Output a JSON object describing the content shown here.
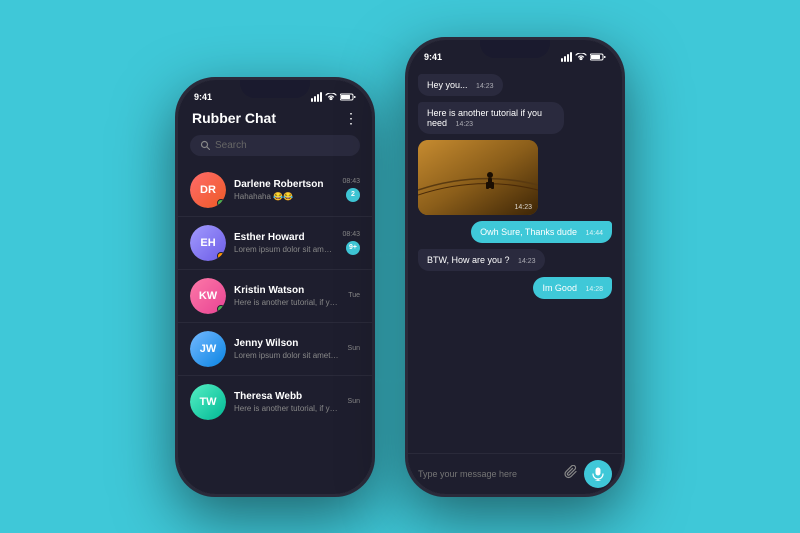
{
  "background_color": "#3fc8d8",
  "phone1": {
    "status_time": "9:41",
    "header_title": "Rubber Chat",
    "more_icon": "⋮",
    "search_placeholder": "Search",
    "chats": [
      {
        "name": "Darlene Robertson",
        "preview": "Hahahaha 😂😂",
        "time": "08:43",
        "badge": "2",
        "online": true,
        "dot_color": "green",
        "initials": "DR",
        "av_class": "av1"
      },
      {
        "name": "Esther Howard",
        "preview": "Lorem ipsum dolor sit amet, conse...",
        "time": "08:43",
        "badge": "9+",
        "online": true,
        "dot_color": "orange",
        "initials": "EH",
        "av_class": "av2"
      },
      {
        "name": "Kristin Watson",
        "preview": "Here is another tutorial, if you...",
        "time": "Tue",
        "badge": "",
        "online": true,
        "dot_color": "green",
        "initials": "KW",
        "av_class": "av3"
      },
      {
        "name": "Jenny Wilson",
        "preview": "Lorem ipsum dolor sit amet, conse...",
        "time": "Sun",
        "badge": "",
        "online": false,
        "dot_color": "",
        "initials": "JW",
        "av_class": "av4"
      },
      {
        "name": "Theresa Webb",
        "preview": "Here is another tutorial, if you...",
        "time": "Sun",
        "badge": "",
        "online": false,
        "dot_color": "",
        "initials": "TW",
        "av_class": "av5"
      }
    ]
  },
  "phone2": {
    "status_time": "9:41",
    "messages": [
      {
        "type": "received",
        "text": "Hey you...",
        "time": "14:23"
      },
      {
        "type": "received",
        "text": "Here is another tutorial if you need",
        "time": "14:23"
      },
      {
        "type": "image",
        "time": "14:23"
      },
      {
        "type": "sent",
        "text": "Owh Sure, Thanks dude",
        "time": "14:44"
      },
      {
        "type": "received",
        "text": "BTW, How are you ?",
        "time": "14:23"
      },
      {
        "type": "sent",
        "text": "Im Good",
        "time": "14:28"
      }
    ],
    "input_placeholder": "Type your message here"
  }
}
